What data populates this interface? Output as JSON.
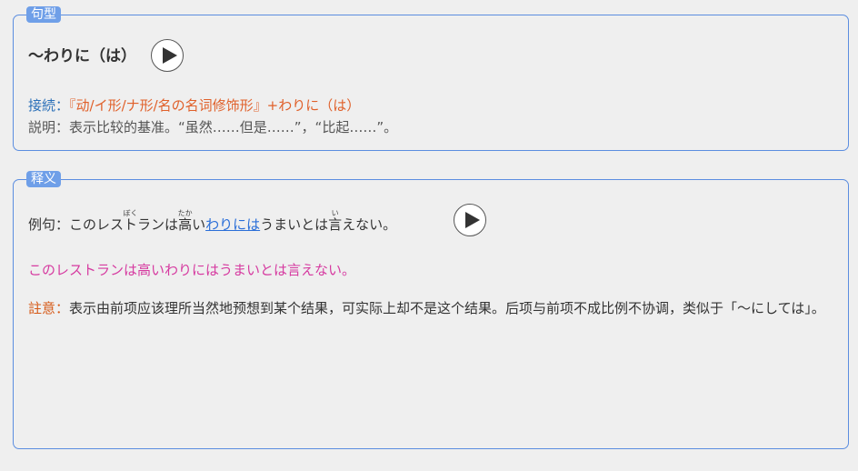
{
  "panels": {
    "pattern_label": "句型",
    "meaning_label": "释义"
  },
  "pattern": {
    "title": "～わりに（は）",
    "connection_label": "接続：",
    "connection_text": "『动/イ形/ナ形/名の名词修饰形』+わりに（は）",
    "explanation_label": "説明：",
    "explanation_text": "表示比较的基准。“虽然……但是……”，“比起……”。"
  },
  "example": {
    "label": "例句：",
    "part1": "このレス",
    "ruby1_base": "ト",
    "ruby1_rt": "ぼく",
    "part2": "ランは",
    "ruby2_base": "高",
    "ruby2_rt": "たか",
    "part3": "い",
    "highlight": "わりには",
    "part4": "うまいとは",
    "ruby3_base": "言",
    "ruby3_rt": "い",
    "part5": "えない。",
    "translation": "このレストランは高いわりにはうまいとは言えない。"
  },
  "note": {
    "label": "註意：",
    "text": "表示由前项应该理所当然地预想到某个结果，可实际上却不是这个结果。后项与前项不成比例不协调，类似于「～にしては」。"
  },
  "icons": {
    "play": "play-icon"
  },
  "colors": {
    "border": "#5b8de0",
    "label_bg": "#6f9fe8",
    "connection_label": "#2a6fb8",
    "connection_text": "#e0602a",
    "highlight": "#2b6fd8",
    "translation": "#d63aa0",
    "note_label": "#d65a18"
  }
}
